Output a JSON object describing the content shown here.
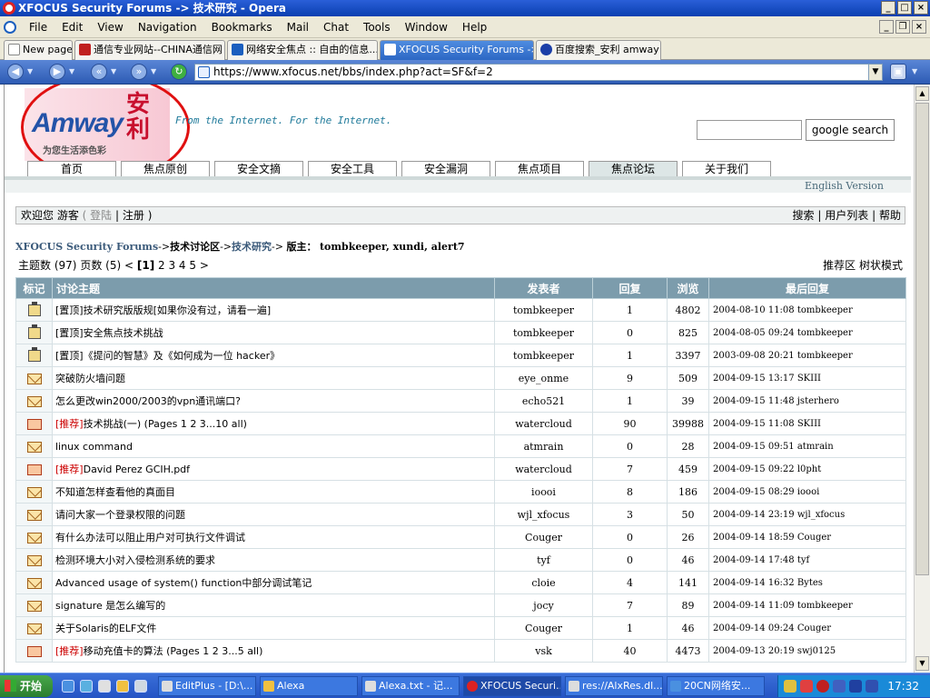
{
  "window": {
    "title": "XFOCUS Security Forums -> 技术研究 - Opera"
  },
  "menu": [
    "File",
    "Edit",
    "View",
    "Navigation",
    "Bookmarks",
    "Mail",
    "Chat",
    "Tools",
    "Window",
    "Help"
  ],
  "tabs": [
    {
      "label": "New page"
    },
    {
      "label": "通信专业网站--CHINA通信网"
    },
    {
      "label": "网络安全焦点 :: 自由的信息..."
    },
    {
      "label": "XFOCUS Security Forums ->"
    },
    {
      "label": "百度搜索_安利 amway"
    }
  ],
  "address": {
    "url": "https://www.xfocus.net/bbs/index.php?act=SF&f=2"
  },
  "header": {
    "logo_text": "Amway",
    "logo_cn": "安利",
    "logo_slogan": "为您生活添色彩",
    "tagline": "From the Internet. For the Internet.",
    "search_button": "google search"
  },
  "nav": [
    "首页",
    "焦点原创",
    "安全文摘",
    "安全工具",
    "安全漏洞",
    "焦点项目",
    "焦点论坛",
    "关于我们"
  ],
  "nav_selected": "焦点论坛",
  "english_version": "English Version",
  "userbar": {
    "welcome": "欢迎您 游客",
    "open": "(",
    "login": "登陆",
    "sep": "|",
    "register": "注册",
    "close": ")",
    "search": "搜索",
    "userlist": "用户列表",
    "help": "帮助"
  },
  "breadcrumb": {
    "forums": "XFOCUS Security Forums",
    "arrow": "->",
    "section": "技术讨论区",
    "topic": "技术研究",
    "mod_label": "版主：",
    "mods": "tombkeeper, xundi, alert7"
  },
  "pager": {
    "topics_label": "主题数",
    "topics": "(97)",
    "pages_label": "页数",
    "pages": "(5)",
    "prev": "<",
    "current": "[1]",
    "others": "2 3 4 5",
    "next": ">"
  },
  "modes": {
    "recommend": "推荐区",
    "tree": "树状模式"
  },
  "table": {
    "headers": [
      "标记",
      "讨论主题",
      "发表者",
      "回复",
      "浏览",
      "最后回复"
    ],
    "rows": [
      {
        "icon": "pin",
        "prefix": "[置顶]",
        "title": "技术研究版版规[如果你没有过，请看一遍]",
        "author": "tombkeeper",
        "replies": "1",
        "views": "4802",
        "last": "2004-08-10 11:08 tombkeeper"
      },
      {
        "icon": "pin",
        "prefix": "[置顶]",
        "title": "安全焦点技术挑战",
        "author": "tombkeeper",
        "replies": "0",
        "views": "825",
        "last": "2004-08-05 09:24 tombkeeper"
      },
      {
        "icon": "pin",
        "prefix": "[置顶]",
        "title": "《提问的智慧》及《如何成为一位 hacker》",
        "author": "tombkeeper",
        "replies": "1",
        "views": "3397",
        "last": "2003-09-08 20:21 tombkeeper"
      },
      {
        "icon": "env",
        "prefix": "",
        "title": "突破防火墙问题",
        "author": "eye_onme",
        "replies": "9",
        "views": "509",
        "last": "2004-09-15 13:17 SKIII"
      },
      {
        "icon": "env",
        "prefix": "",
        "title": "怎么更改win2000/2003的vpn通讯端口?",
        "author": "echo521",
        "replies": "1",
        "views": "39",
        "last": "2004-09-15 11:48 jsterhero"
      },
      {
        "icon": "hot",
        "prefix": "[推荐]",
        "title": "技术挑战(一) (Pages 1 2 3...10 all)",
        "author": "watercloud",
        "replies": "90",
        "views": "39988",
        "last": "2004-09-15 11:08 SKIII"
      },
      {
        "icon": "env",
        "prefix": "",
        "title": "linux command",
        "author": "atmrain",
        "replies": "0",
        "views": "28",
        "last": "2004-09-15 09:51 atmrain"
      },
      {
        "icon": "hot",
        "prefix": "[推荐]",
        "title": "David Perez GCIH.pdf",
        "author": "watercloud",
        "replies": "7",
        "views": "459",
        "last": "2004-09-15 09:22 l0pht"
      },
      {
        "icon": "env",
        "prefix": "",
        "title": "不知道怎样查看他的真面目",
        "author": "ioooi",
        "replies": "8",
        "views": "186",
        "last": "2004-09-15 08:29 ioooi"
      },
      {
        "icon": "env",
        "prefix": "",
        "title": "请问大家一个登录权限的问题",
        "author": "wjl_xfocus",
        "replies": "3",
        "views": "50",
        "last": "2004-09-14 23:19 wjl_xfocus"
      },
      {
        "icon": "env",
        "prefix": "",
        "title": "有什么办法可以阻止用户对可执行文件调试",
        "author": "Couger",
        "replies": "0",
        "views": "26",
        "last": "2004-09-14 18:59 Couger"
      },
      {
        "icon": "env",
        "prefix": "",
        "title": "检测环境大小对入侵检测系统的要求",
        "author": "tyf",
        "replies": "0",
        "views": "46",
        "last": "2004-09-14 17:48 tyf"
      },
      {
        "icon": "env",
        "prefix": "",
        "title": "Advanced usage of system() function中部分调试笔记",
        "author": "cloie",
        "replies": "4",
        "views": "141",
        "last": "2004-09-14 16:32 Bytes"
      },
      {
        "icon": "env",
        "prefix": "",
        "title": "signature 是怎么编写的",
        "author": "jocy",
        "replies": "7",
        "views": "89",
        "last": "2004-09-14 11:09 tombkeeper"
      },
      {
        "icon": "env",
        "prefix": "",
        "title": "关于Solaris的ELF文件",
        "author": "Couger",
        "replies": "1",
        "views": "46",
        "last": "2004-09-14 09:24 Couger"
      },
      {
        "icon": "hot",
        "prefix": "[推荐]",
        "title": "移动充值卡的算法 (Pages 1 2 3...5 all)",
        "author": "vsk",
        "replies": "40",
        "views": "4473",
        "last": "2004-09-13 20:19 swj0125"
      }
    ]
  },
  "taskbar": {
    "start": "开始",
    "tasks": [
      "EditPlus - [D:\\...",
      "Alexa",
      "Alexa.txt - 记...",
      "XFOCUS Securi...",
      "res://AlxRes.dl...",
      "20CN网络安..."
    ],
    "clock": "17:32"
  },
  "colors": {
    "table_header": "#7c9cac",
    "accent": "#2353a8",
    "recommend": "#cc0000"
  }
}
